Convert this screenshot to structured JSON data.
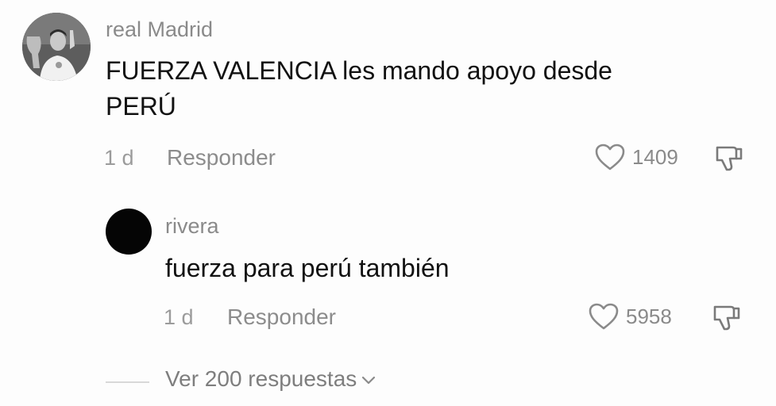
{
  "main_comment": {
    "username": "real Madrid",
    "text_line1": "FUERZA VALENCIA les mando apoyo desde",
    "text_line2": "PERÚ",
    "age": "1 d",
    "reply_label": "Responder",
    "likes": "1409",
    "avatar_icon": "profile-photo"
  },
  "reply_comment": {
    "username": "rivera",
    "text": "fuerza para perú también",
    "age": "1 d",
    "reply_label": "Responder",
    "likes": "5958",
    "avatar_icon": "profile-photo-black"
  },
  "view_replies": {
    "label": "Ver 200 respuestas",
    "icon": "chevron-down-icon"
  },
  "icons": {
    "like": "heart-outline-icon",
    "dislike": "thumbs-down-icon"
  }
}
